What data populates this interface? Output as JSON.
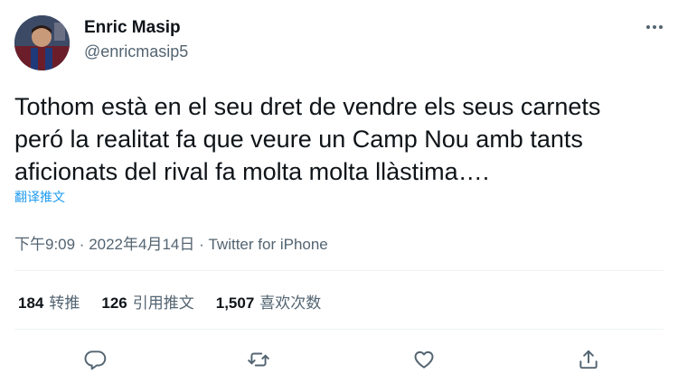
{
  "author": {
    "name": "Enric Masip",
    "handle": "@enricmasip5"
  },
  "tweet": {
    "text": "Tothom està en el seu dret de vendre els seus carnets\nperó la realitat fa que veure un Camp Nou amb tants\naficionats del rival fa molta molta llàstima….",
    "translate_label": "翻译推文"
  },
  "meta": "下午9:09 · 2022年4月14日 · Twitter for iPhone",
  "stats": {
    "retweets": {
      "count": "184",
      "label": "转推"
    },
    "quotes": {
      "count": "126",
      "label": "引用推文"
    },
    "likes": {
      "count": "1,507",
      "label": "喜欢次数"
    }
  },
  "icons": {
    "more": "more-dots-icon",
    "reply": "reply-icon",
    "retweet": "retweet-icon",
    "like": "heart-icon",
    "share": "share-icon"
  },
  "colors": {
    "accent": "#1d9bf0",
    "secondary_text": "#536471",
    "primary_text": "#0f1419",
    "divider": "#eff3f4"
  }
}
